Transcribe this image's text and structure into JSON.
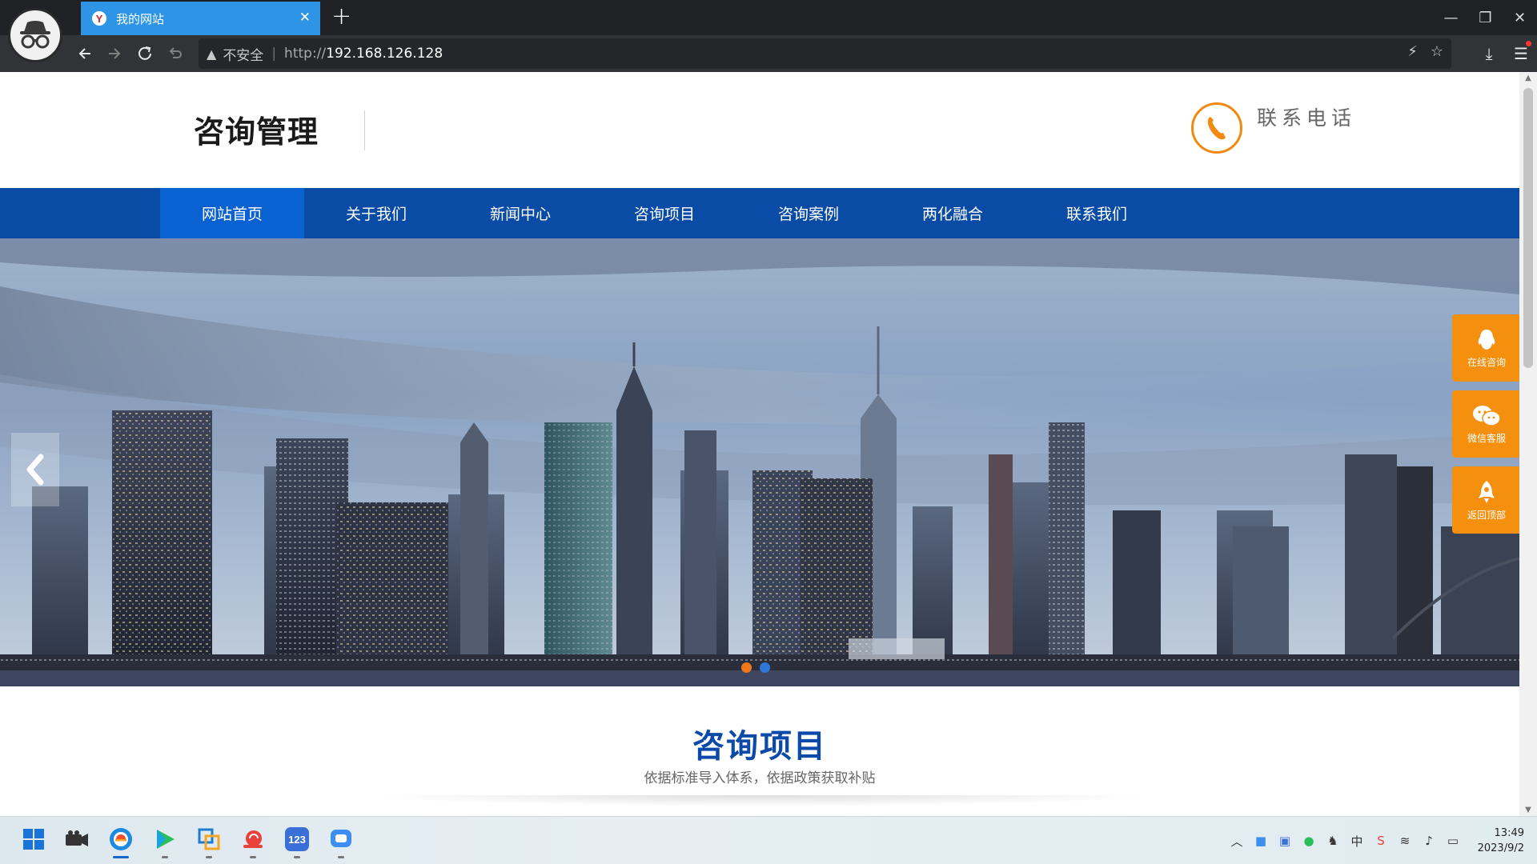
{
  "browser": {
    "tab": {
      "title": "我的网站",
      "favicon": "Y"
    },
    "address": {
      "security_warning": "不安全",
      "protocol": "http://",
      "host": "192.168.126.128"
    }
  },
  "site": {
    "logo_text": "咨询管理",
    "contact_label": "联系电话",
    "nav": [
      {
        "label": "网站首页",
        "active": true
      },
      {
        "label": "关于我们",
        "active": false
      },
      {
        "label": "新闻中心",
        "active": false
      },
      {
        "label": "咨询项目",
        "active": false
      },
      {
        "label": "咨询案例",
        "active": false
      },
      {
        "label": "两化融合",
        "active": false
      },
      {
        "label": "联系我们",
        "active": false
      }
    ],
    "float_panels": [
      {
        "label": "在线咨询",
        "icon": "qq-penguin-icon"
      },
      {
        "label": "微信客服",
        "icon": "wechat-icon"
      },
      {
        "label": "返回顶部",
        "icon": "rocket-icon"
      }
    ],
    "section": {
      "title": "咨询项目",
      "subtitle": "依据标准导入体系，依据政策获取补贴"
    }
  },
  "taskbar": {
    "time": "13:49",
    "date": "2023/9/2",
    "ime": "中"
  },
  "colors": {
    "nav_bg": "#0a4ba6",
    "nav_active": "#0a62d2",
    "accent_orange": "#f5900f",
    "section_title": "#0b4aa8",
    "tab_active": "#2e95e6"
  }
}
